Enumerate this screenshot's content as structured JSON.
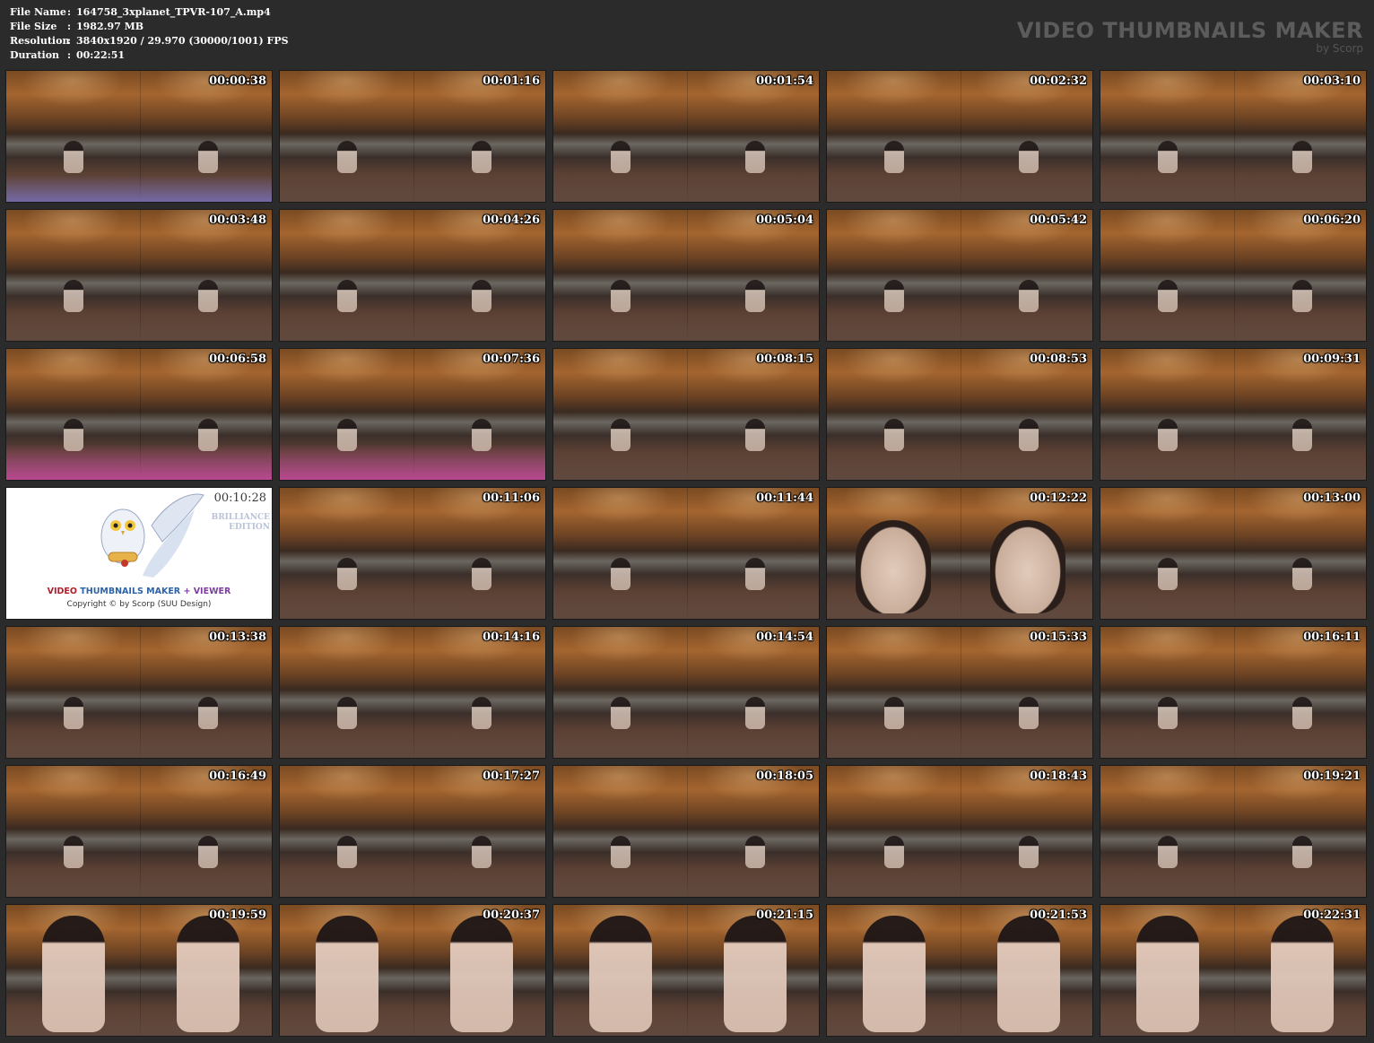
{
  "file_info": [
    {
      "label": "File Name",
      "value": "164758_3xplanet_TPVR-107_A.mp4"
    },
    {
      "label": "File Size",
      "value": "1982.97 MB"
    },
    {
      "label": "Resolution",
      "value": "3840x1920 / 29.970 (30000/1001) FPS"
    },
    {
      "label": "Duration",
      "value": "00:22:51"
    }
  ],
  "separator": ":",
  "brand": {
    "title": "VIDEO THUMBNAILS MAKER",
    "subtitle": "by Scorp"
  },
  "logo_tile": {
    "timestamp": "00:10:28",
    "edition": "BRILLIANCE\nEDITION",
    "title_part1": "VIDEO",
    "title_part2": "THUMBNAILS MAKER",
    "title_part3": "+ VIEWER",
    "copyright": "Copyright © by Scorp (SUU Design)",
    "owl_icon": "owl-with-scroll-icon"
  },
  "thumbnails": [
    {
      "time": "00:00:38",
      "style": "bed-purple"
    },
    {
      "time": "00:01:16",
      "style": ""
    },
    {
      "time": "00:01:54",
      "style": ""
    },
    {
      "time": "00:02:32",
      "style": ""
    },
    {
      "time": "00:03:10",
      "style": ""
    },
    {
      "time": "00:03:48",
      "style": ""
    },
    {
      "time": "00:04:26",
      "style": ""
    },
    {
      "time": "00:05:04",
      "style": ""
    },
    {
      "time": "00:05:42",
      "style": ""
    },
    {
      "time": "00:06:20",
      "style": ""
    },
    {
      "time": "00:06:58",
      "style": "bed-pink"
    },
    {
      "time": "00:07:36",
      "style": "bed-pink"
    },
    {
      "time": "00:08:15",
      "style": ""
    },
    {
      "time": "00:08:53",
      "style": ""
    },
    {
      "time": "00:09:31",
      "style": ""
    },
    {
      "time": "LOGO",
      "style": "logo"
    },
    {
      "time": "00:11:06",
      "style": ""
    },
    {
      "time": "00:11:44",
      "style": ""
    },
    {
      "time": "00:12:22",
      "style": "close-face"
    },
    {
      "time": "00:13:00",
      "style": ""
    },
    {
      "time": "00:13:38",
      "style": ""
    },
    {
      "time": "00:14:16",
      "style": ""
    },
    {
      "time": "00:14:54",
      "style": ""
    },
    {
      "time": "00:15:33",
      "style": ""
    },
    {
      "time": "00:16:11",
      "style": ""
    },
    {
      "time": "00:16:49",
      "style": ""
    },
    {
      "time": "00:17:27",
      "style": ""
    },
    {
      "time": "00:18:05",
      "style": ""
    },
    {
      "time": "00:18:43",
      "style": ""
    },
    {
      "time": "00:19:21",
      "style": ""
    },
    {
      "time": "00:19:59",
      "style": "close-body"
    },
    {
      "time": "00:20:37",
      "style": "close-body"
    },
    {
      "time": "00:21:15",
      "style": "close-body"
    },
    {
      "time": "00:21:53",
      "style": "close-body"
    },
    {
      "time": "00:22:31",
      "style": "close-body"
    }
  ]
}
